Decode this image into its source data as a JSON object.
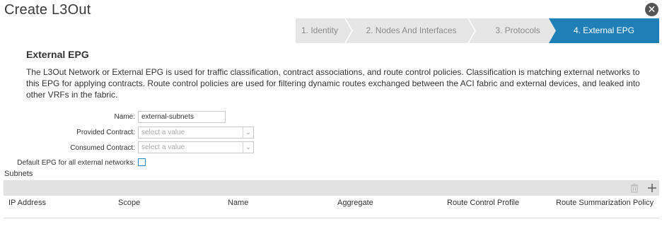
{
  "window": {
    "title": "Create L3Out",
    "close_glyph": "✕"
  },
  "wizard": {
    "steps": [
      {
        "label": "1. Identity",
        "state": "completed"
      },
      {
        "label": "2. Nodes And Interfaces",
        "state": "completed"
      },
      {
        "label": "3. Protocols",
        "state": "completed"
      },
      {
        "label": "4. External EPG",
        "state": "active"
      }
    ],
    "active_color": "#1f7fb6"
  },
  "section": {
    "heading": "External EPG",
    "description": "The L3Out Network or External EPG is used for traffic classification, contract associations, and route control policies. Classification is matching external networks to this EPG for applying contracts. Route control policies are used for filtering dynamic routes exchanged between the ACI fabric and external devices, and leaked into other VRFs in the fabric."
  },
  "form": {
    "name_label": "Name:",
    "name_value": "external-subnets",
    "provided_label": "Provided Contract:",
    "provided_placeholder": "select a value",
    "consumed_label": "Consumed Contract:",
    "consumed_placeholder": "select a value",
    "default_epg_label": "Default EPG for all external networks:",
    "default_epg_checked": false
  },
  "subnets": {
    "label": "Subnets",
    "toolbar": {
      "delete_icon": "trash-icon",
      "add_icon": "plus-icon"
    },
    "columns": [
      "IP Address",
      "Scope",
      "Name",
      "Aggregate",
      "Route Control Profile",
      "Route Summarization Policy"
    ],
    "rows": []
  }
}
